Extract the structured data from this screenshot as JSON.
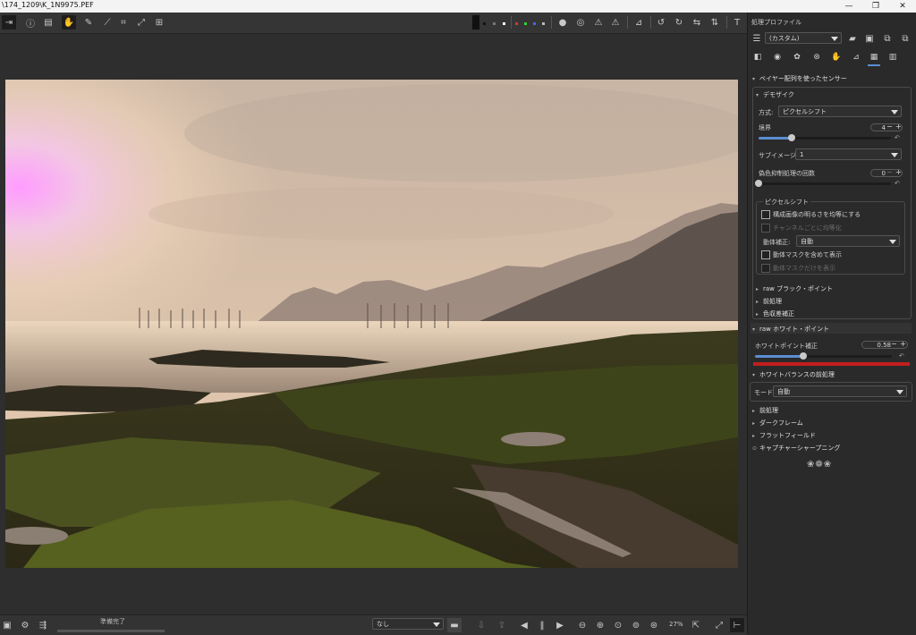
{
  "window": {
    "title": "\\174_1209\\K_1N9975.PEF",
    "minimize": "—",
    "maximize": "❐",
    "close": "✕"
  },
  "toolbar": {
    "left_icons": [
      "sidebar-toggle-icon",
      "info-icon",
      "before-after-icon",
      "hand-icon",
      "color-picker-icon",
      "straighten-icon",
      "crop-icon",
      "perspective-icon",
      "warp-icon"
    ],
    "right_icons": [
      "focus-mask-icon",
      "warning-shadow-icon",
      "warning-highlight-icon",
      "histogram-icon",
      "rotate-left-icon",
      "rotate-right-icon",
      "flip-h-icon",
      "flip-v-icon",
      "text-icon"
    ]
  },
  "panel": {
    "title": "処理プロファイル",
    "profile_value": "(カスタム)",
    "sections": {
      "bayer": "ベイヤー配列を使ったセンサー",
      "demosaic": "デモザイク",
      "method_label": "方式:",
      "method_value": "ピクセルシフト",
      "border_label": "境界",
      "border_value": "4",
      "subimage_label": "サブイメージ:",
      "subimage_value": "1",
      "false_color_label": "偽色抑制処理の回数",
      "false_color_value": "0",
      "pixelshift_title": "ピクセルシフト",
      "cb_equalize_brightness": "構成画像の明るさを均等にする",
      "cb_equalize_channel": "チャンネルごとに均等化",
      "motion_label": "動体補正:",
      "motion_value": "自動",
      "cb_show_motion_mask": "動体マスクを含めて表示",
      "cb_show_motion_mask_only": "動体マスクだけを表示",
      "raw_black": "raw ブラック・ポイント",
      "preprocess": "前処理",
      "ca_correction": "色収差補正",
      "raw_white": "raw ホワイト・ポイント",
      "white_correction_label": "ホワイトポイント補正",
      "white_correction_value": "0.58",
      "wb_preprocess": "ホワイトバランスの前処理",
      "mode_label": "モード:",
      "mode_value": "自動",
      "pre_processing": "前処理",
      "dark_frame": "ダークフレーム",
      "flat_field": "フラットフィールド",
      "capture_sharpening": "キャプチャーシャープニング"
    },
    "border_fraction": 0.25,
    "false_color_fraction": 0.0,
    "white_correction_fraction": 0.35
  },
  "statusbar": {
    "status_text": "準備完了",
    "filter_value": "なし",
    "zoom": "27%"
  },
  "colors": {
    "accent": "#5b8ed1",
    "highlight_bar": "#c21e1e"
  }
}
